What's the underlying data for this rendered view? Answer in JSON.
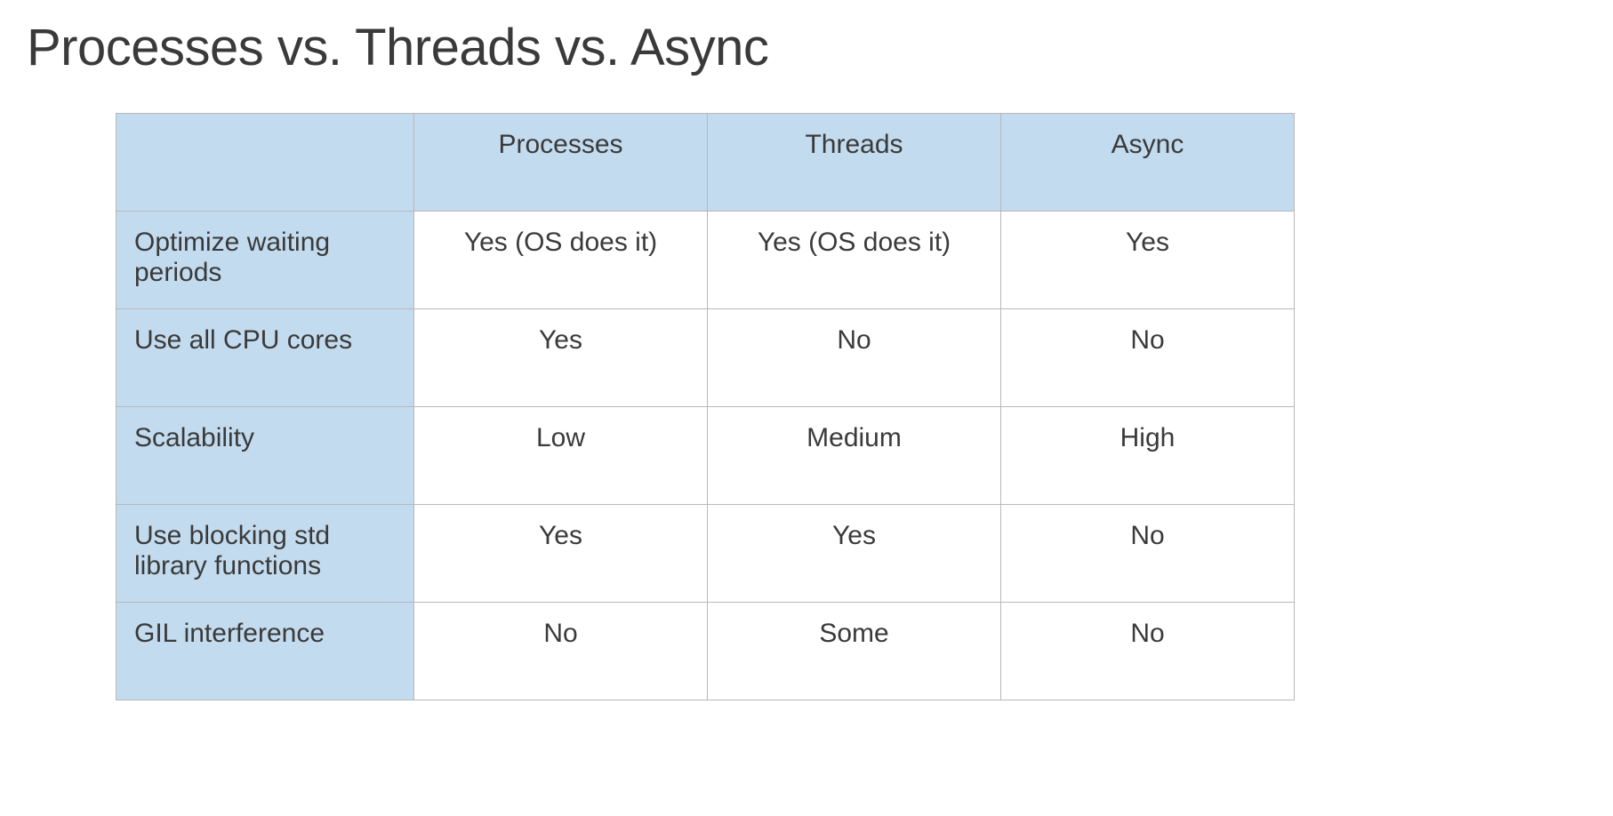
{
  "title": "Processes vs. Threads vs. Async",
  "chart_data": {
    "type": "table",
    "columns": [
      "",
      "Processes",
      "Threads",
      "Async"
    ],
    "rows": [
      {
        "label": "Optimize waiting periods",
        "cells": [
          "Yes (OS does it)",
          "Yes (OS does it)",
          "Yes"
        ]
      },
      {
        "label": "Use all CPU cores",
        "cells": [
          "Yes",
          "No",
          "No"
        ]
      },
      {
        "label": "Scalability",
        "cells": [
          "Low",
          "Medium",
          "High"
        ]
      },
      {
        "label": "Use blocking std library functions",
        "cells": [
          "Yes",
          "Yes",
          "No"
        ]
      },
      {
        "label": "GIL interference",
        "cells": [
          "No",
          "Some",
          "No"
        ]
      }
    ]
  }
}
